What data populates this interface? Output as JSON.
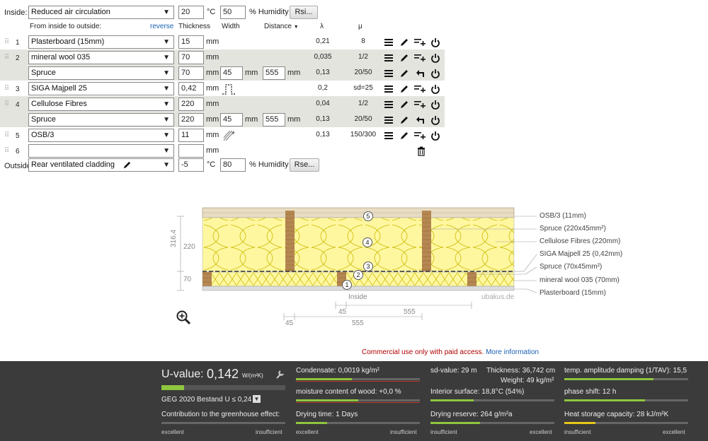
{
  "inside": {
    "label": "Inside:",
    "climate": "Reduced air circulation",
    "temp": "20",
    "temp_unit": "°C",
    "humidity": "50",
    "humidity_unit": "% Humidity",
    "rsi_btn": "Rsi..."
  },
  "header": {
    "order_label": "From inside to outside:",
    "reverse": "reverse",
    "thickness": "Thickness",
    "width": "Width",
    "distance": "Distance",
    "lambda": "λ",
    "mu": "μ"
  },
  "layers": [
    {
      "num": "1",
      "material": "Plasterboard (15mm)",
      "thickness": "15",
      "unit": "mm",
      "lambda": "0,21",
      "mu": "8"
    },
    {
      "num": "2",
      "material": "mineral wool 035",
      "thickness": "70",
      "unit": "mm",
      "lambda": "0,035",
      "mu": "1/2"
    },
    {
      "num": "",
      "material": "Spruce",
      "thickness": "70",
      "unit": "mm",
      "width": "45",
      "width_unit": "mm",
      "distance": "555",
      "distance_unit": "mm",
      "lambda": "0,13",
      "mu": "20/50"
    },
    {
      "num": "3",
      "material": "SIGA Majpell 25",
      "thickness": "0,42",
      "unit": "mm",
      "lambda": "0,2",
      "mu": "sd=25"
    },
    {
      "num": "4",
      "material": "Cellulose Fibres",
      "thickness": "220",
      "unit": "mm",
      "lambda": "0,04",
      "mu": "1/2"
    },
    {
      "num": "",
      "material": "Spruce",
      "thickness": "220",
      "unit": "mm",
      "width": "45",
      "width_unit": "mm",
      "distance": "555",
      "distance_unit": "mm",
      "lambda": "0,13",
      "mu": "20/50"
    },
    {
      "num": "5",
      "material": "OSB/3",
      "thickness": "11",
      "unit": "mm",
      "lambda": "0,13",
      "mu": "150/300"
    },
    {
      "num": "6",
      "material": "",
      "thickness": "",
      "unit": "mm",
      "lambda": "",
      "mu": ""
    }
  ],
  "outside": {
    "label": "Outside",
    "climate": "Rear ventilated cladding",
    "temp": "-5",
    "temp_unit": "°C",
    "humidity": "80",
    "humidity_unit": "% Humidity",
    "rse_btn": "Rse..."
  },
  "diagram": {
    "legend": [
      "OSB/3 (11mm)",
      "Spruce (220x45mm²)",
      "Cellulose Fibres (220mm)",
      "SIGA Majpell 25 (0,42mm)",
      "Spruce (70x45mm²)",
      "mineral wool 035 (70mm)",
      "Plasterboard (15mm)"
    ],
    "dim_total": "316,4",
    "dim_220": "220",
    "dim_70": "70",
    "inside_label": "Inside",
    "watermark": "ubakus.de",
    "dim_45a": "45",
    "dim_555a": "555",
    "dim_45b": "45",
    "dim_555b": "555",
    "markers": [
      "1",
      "2",
      "3",
      "4",
      "5"
    ]
  },
  "notice": {
    "text": "Commercial use only with paid access.",
    "link": "More information"
  },
  "results": {
    "u_label": "U-value:",
    "u_value": "0,142",
    "u_unit": "W/(m²K)",
    "geg": "GEG 2020 Bestand U ≤ 0,24",
    "greenhouse": "Contribution to the greenhouse effect:",
    "condensate": "Condensate: 0,0019 kg/m²",
    "wood_moisture": "moisture content of wood: +0,0 %",
    "drying_time": "Drying time: 1 Days",
    "sd_value": "sd-value: 29 m",
    "thickness": "Thickness: 36,742 cm",
    "weight": "Weight: 49 kg/m²",
    "interior_surface": "Interior surface: 18,8°C (54%)",
    "drying_reserve": "Drying reserve: 264 g/m²a",
    "temp_amp": "temp. amplitude damping (1/TAV): 15,5",
    "phase_shift": "phase shift: 12 h",
    "heat_storage": "Heat storage capacity: 28 kJ/m²K",
    "excellent": "excellent",
    "insufficient": "insufficient",
    "levels": {
      "u": 0.18,
      "condensate": 0.45,
      "wood": 0.5,
      "drying_time": 0.25,
      "interior_surface": 0.35,
      "drying_reserve": 0.4,
      "temp_amp": 0.72,
      "phase_shift": 0.65,
      "heat_storage": 0.25
    }
  }
}
